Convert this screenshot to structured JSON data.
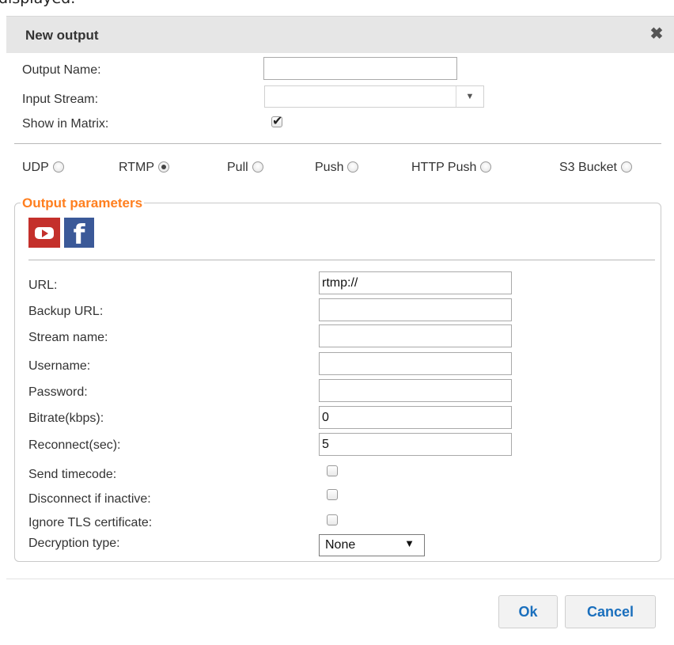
{
  "page_top_clipped_text": "displayed.",
  "dialog": {
    "title": "New output",
    "close_icon": "close-icon",
    "close_glyph": "✖"
  },
  "general": {
    "output_name_label": "Output Name:",
    "output_name_value": "",
    "input_stream_label": "Input Stream:",
    "input_stream_value": "",
    "show_in_matrix_label": "Show in Matrix:",
    "show_in_matrix_checked": true,
    "checkmark_glyph": "✔"
  },
  "protocols": [
    {
      "label": "UDP",
      "selected": false
    },
    {
      "label": "RTMP",
      "selected": true
    },
    {
      "label": "Pull",
      "selected": false
    },
    {
      "label": "Push",
      "selected": false
    },
    {
      "label": "HTTP Push",
      "selected": false
    },
    {
      "label": "S3 Bucket",
      "selected": false
    }
  ],
  "output_parameters": {
    "legend": "Output parameters",
    "icons": [
      "youtube-icon",
      "facebook-icon"
    ],
    "facebook_glyph": "f",
    "url_label": "URL:",
    "url_value": "rtmp://",
    "backup_url_label": "Backup URL:",
    "backup_url_value": "",
    "stream_name_label": "Stream name:",
    "stream_name_value": "",
    "username_label": "Username:",
    "username_value": "",
    "password_label": "Password:",
    "password_value": "",
    "bitrate_label": "Bitrate(kbps):",
    "bitrate_value": "0",
    "reconnect_label": "Reconnect(sec):",
    "reconnect_value": "5",
    "send_timecode_label": "Send timecode:",
    "send_timecode_checked": false,
    "disconnect_label": "Disconnect if inactive:",
    "disconnect_checked": false,
    "ignore_tls_label": "Ignore TLS certificate:",
    "ignore_tls_checked": false,
    "decryption_label": "Decryption type:",
    "decryption_value": "None",
    "dropdown_arrow_glyph": "▼",
    "combo_arrow_glyph": "▼"
  },
  "buttons": {
    "ok": "Ok",
    "cancel": "Cancel"
  }
}
